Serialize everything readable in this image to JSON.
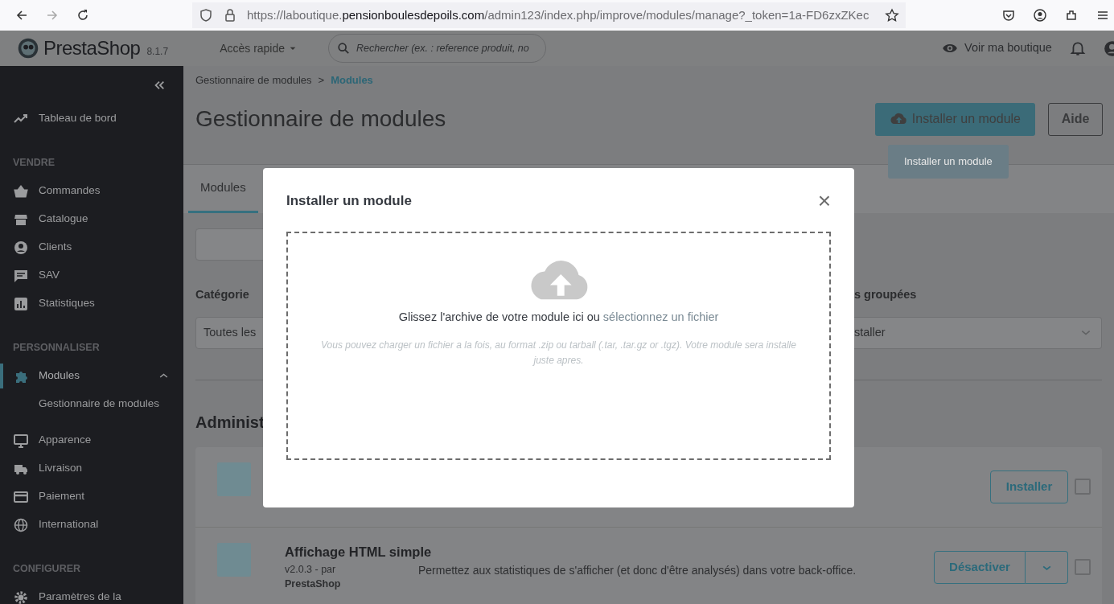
{
  "browser": {
    "url_prefix": "https://laboutique.",
    "url_domain": "pensionboulesdepoils.com",
    "url_path": "/admin123/index.php/improve/modules/manage?_token=1a-FD6zxZKec"
  },
  "header": {
    "brand": "PrestaShop",
    "version": "8.1.7",
    "quick_access": "Accès rapide",
    "search": {
      "placeholder": "Rechercher (ex. : reference produit, no"
    },
    "view_shop": "Voir ma boutique"
  },
  "sidebar": {
    "items": [
      {
        "kind": "link",
        "label": "Tableau de bord",
        "selected": false
      },
      {
        "kind": "section",
        "label": "VENDRE"
      },
      {
        "kind": "link",
        "label": "Commandes",
        "selected": false
      },
      {
        "kind": "link",
        "label": "Catalogue",
        "selected": false
      },
      {
        "kind": "link",
        "label": "Clients",
        "selected": false
      },
      {
        "kind": "link",
        "label": "SAV",
        "selected": false
      },
      {
        "kind": "link",
        "label": "Statistiques",
        "selected": false
      },
      {
        "kind": "section",
        "label": "PERSONNALISER"
      },
      {
        "kind": "link",
        "label": "Modules",
        "selected": true,
        "expanded": true,
        "children": [
          {
            "label": "Gestionnaire de modules"
          }
        ]
      },
      {
        "kind": "link",
        "label": "Apparence",
        "selected": false
      },
      {
        "kind": "link",
        "label": "Livraison",
        "selected": false
      },
      {
        "kind": "link",
        "label": "Paiement",
        "selected": false
      },
      {
        "kind": "link",
        "label": "International",
        "selected": false
      },
      {
        "kind": "section",
        "label": "CONFIGURER"
      },
      {
        "kind": "link",
        "label": "Paramètres de la",
        "selected": false
      }
    ]
  },
  "breadcrumb": [
    {
      "label": "Gestionnaire de modules",
      "current": false
    },
    {
      "label": "Modules",
      "current": true
    }
  ],
  "breadcrumb_separator": ">",
  "page_title": "Gestionnaire de modules",
  "install_button": "Installer un module",
  "help_button": "Aide",
  "tooltip": "Installer un module",
  "tabs": [
    {
      "label": "Modules",
      "selected": true
    }
  ],
  "filters": {
    "category_label": "Catégorie",
    "category_value": "Toutes les",
    "bulk_label": "s groupées",
    "bulk_value": "staller"
  },
  "section_title": "Administ",
  "modules": [
    {
      "action": "Installer",
      "has_dropdown": false,
      "checked": false
    },
    {
      "title": "Affichage HTML simple",
      "version": "v2.0.3 - par",
      "author": "PrestaShop",
      "description": "Permettez aux statistiques de s'afficher (et donc d'être analysés) dans votre back-office.",
      "action": "Désactiver",
      "has_dropdown": true,
      "checked": false
    }
  ],
  "modal": {
    "title": "Installer un module",
    "close": "×",
    "drop_text": "Glissez l'archive de votre module ici ou ",
    "drop_link": "sélectionnez un fichier",
    "hint": "Vous pouvez charger un fichier a la fois, au format .zip ou tarball (.tar, .tar.gz or .tgz). Votre module sera installe juste apres."
  }
}
